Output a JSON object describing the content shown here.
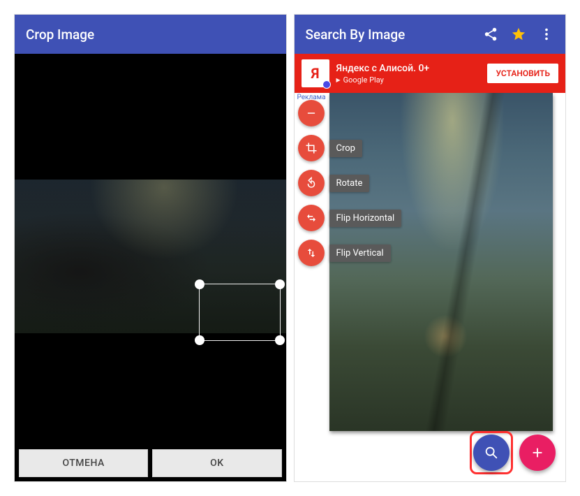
{
  "left": {
    "title": "Crop Image",
    "cancel": "ОТМЕНА",
    "ok": "OK"
  },
  "right": {
    "title": "Search By Image",
    "ad": {
      "icon_letter": "Я",
      "title": "Яндекс с Алисой. 0+",
      "store": "Google Play",
      "cta": "УСТАНОВИТЬ",
      "tag": "Реклама"
    },
    "tools": {
      "crop": "Crop",
      "rotate": "Rotate",
      "flip_h": "Flip Horizontal",
      "flip_v": "Flip Vertical"
    }
  }
}
